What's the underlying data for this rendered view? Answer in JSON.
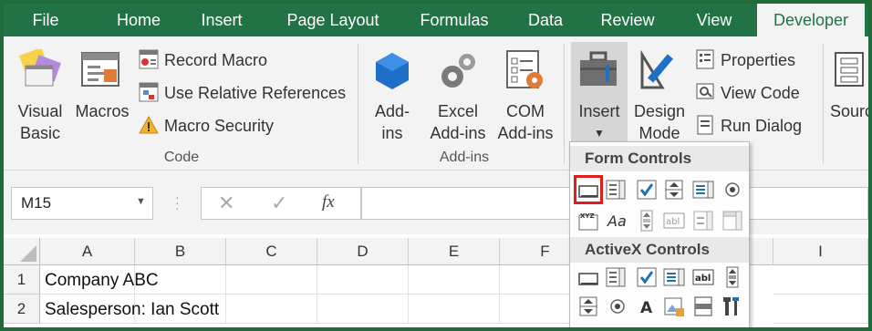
{
  "tabs": [
    "File",
    "Home",
    "Insert",
    "Page Layout",
    "Formulas",
    "Data",
    "Review",
    "View",
    "Developer"
  ],
  "active_tab": "Developer",
  "ribbon": {
    "code": {
      "visual_basic": [
        "Visual",
        "Basic"
      ],
      "macros": "Macros",
      "record_macro": "Record Macro",
      "use_relative": "Use Relative References",
      "macro_security": "Macro Security",
      "label": "Code"
    },
    "addins": {
      "addins": [
        "Add-",
        "ins"
      ],
      "excel_addins": [
        "Excel",
        "Add-ins"
      ],
      "com_addins": [
        "COM",
        "Add-ins"
      ],
      "label": "Add-ins"
    },
    "controls": {
      "insert": "Insert",
      "design_mode": [
        "Design",
        "Mode"
      ],
      "properties": "Properties",
      "view_code": "View Code",
      "run_dialog": "Run Dialog"
    },
    "source": "Sourc"
  },
  "formula_bar": {
    "name_box": "M15",
    "fx": "fx"
  },
  "columns": [
    "A",
    "B",
    "C",
    "D",
    "E",
    "F",
    "",
    "",
    "I"
  ],
  "rows": [
    {
      "num": "1",
      "a": "Company ABC"
    },
    {
      "num": "2",
      "a": "Salesperson: Ian Scott"
    }
  ],
  "dropdown": {
    "form_controls": "Form Controls",
    "activex_controls": "ActiveX Controls",
    "form_items": [
      "button-control",
      "combo-box-control",
      "check-box-control",
      "spin-button-control",
      "list-box-control",
      "option-button-control",
      "group-box-control",
      "label-control",
      "scroll-bar-control",
      "text-field-control",
      "combo-list-edit-control",
      "combo-drop-down-edit-control"
    ],
    "activex_items": [
      "command-button-activex",
      "combo-box-activex",
      "check-box-activex",
      "list-box-activex",
      "text-box-activex",
      "scroll-bar-activex",
      "spin-button-activex",
      "option-button-activex",
      "label-activex",
      "image-activex",
      "toggle-button-activex",
      "more-controls-activex"
    ]
  },
  "colors": {
    "accent": "#217346",
    "highlight": "#e31b1b",
    "check": "#1f6fb5"
  }
}
